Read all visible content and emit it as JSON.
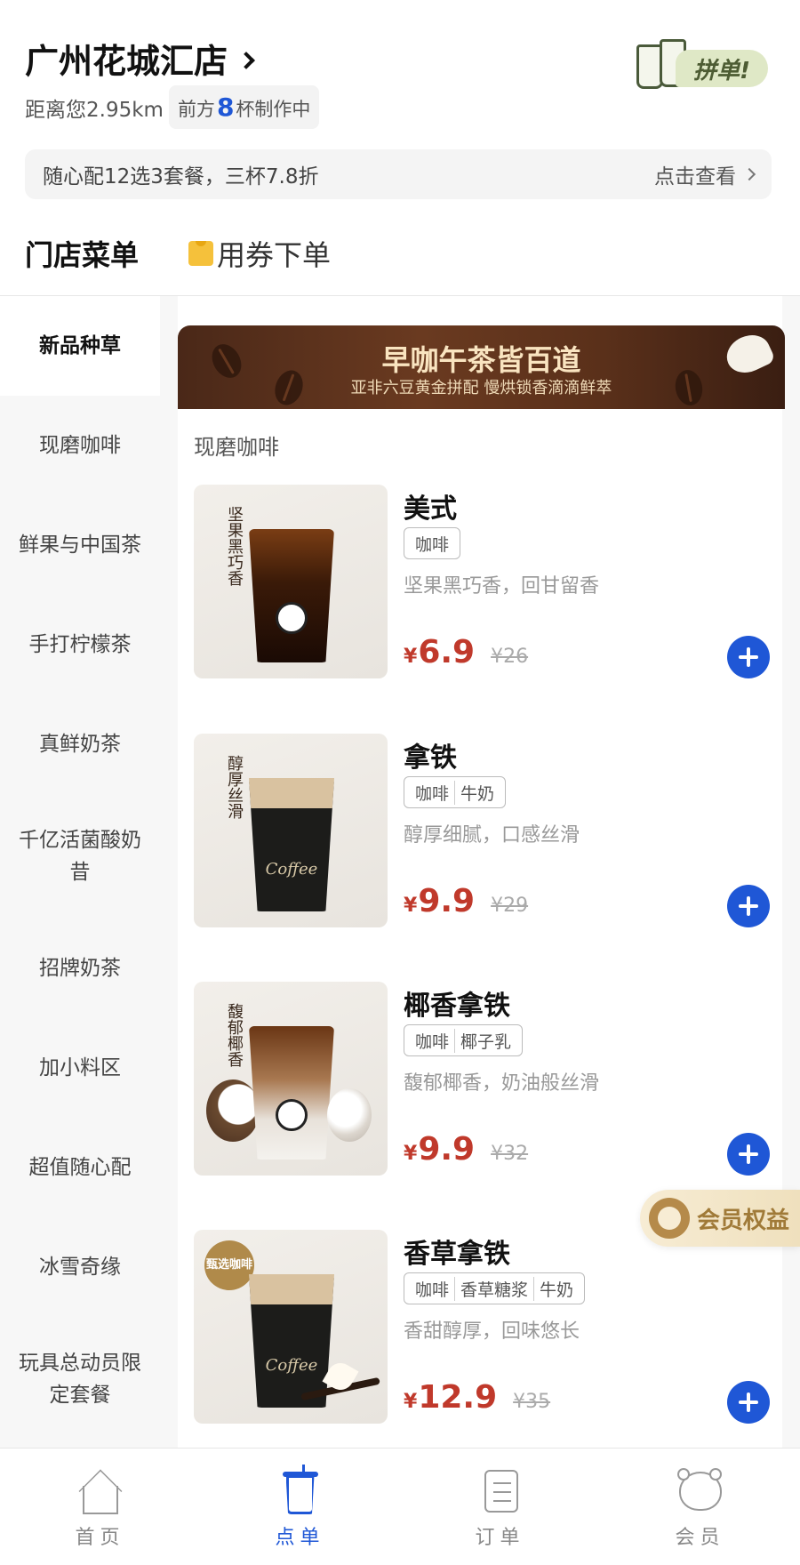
{
  "header": {
    "store_name": "广州花城汇店",
    "distance": "距离您2.95km",
    "queue_prefix": "前方",
    "queue_count": "8",
    "queue_suffix": "杯制作中",
    "group_order_label": "拼单!"
  },
  "promo": {
    "text": "随心配12选3套餐，三杯7.8折",
    "link": "点击查看"
  },
  "tabs": [
    {
      "label": "门店菜单",
      "active": true
    },
    {
      "label": "用券下单",
      "active": false
    }
  ],
  "sidebar": {
    "items": [
      {
        "label": "新品种草",
        "active": true
      },
      {
        "label": "现磨咖啡"
      },
      {
        "label": "鲜果与中国茶"
      },
      {
        "label": "手打柠檬茶"
      },
      {
        "label": "真鲜奶茶"
      },
      {
        "label": "千亿活菌酸奶昔"
      },
      {
        "label": "招牌奶茶"
      },
      {
        "label": "加小料区"
      },
      {
        "label": "超值随心配"
      },
      {
        "label": "冰雪奇缘"
      },
      {
        "label": "玩具总动员限定套餐"
      }
    ]
  },
  "banner": {
    "title": "早咖午茶皆百道",
    "subtitle": "亚非六豆黄金拼配  慢烘锁香滴滴鲜萃"
  },
  "section_title": "现磨咖啡",
  "products": [
    {
      "name": "美式",
      "tags": [
        "咖啡"
      ],
      "desc": "坚果黑巧香，回甘留香",
      "currency": "¥",
      "price": "6.9",
      "old_price": "¥26",
      "image_text": "坚果黑巧香"
    },
    {
      "name": "拿铁",
      "tags": [
        "咖啡",
        "牛奶"
      ],
      "desc": "醇厚细腻，口感丝滑",
      "currency": "¥",
      "price": "9.9",
      "old_price": "¥29",
      "image_text": "醇厚丝滑",
      "cup_brand": "Coffee"
    },
    {
      "name": "椰香拿铁",
      "tags": [
        "咖啡",
        "椰子乳"
      ],
      "desc": "馥郁椰香，奶油般丝滑",
      "currency": "¥",
      "price": "9.9",
      "old_price": "¥32",
      "image_text": "馥郁椰香"
    },
    {
      "name": "香草拿铁",
      "tags": [
        "咖啡",
        "香草糖浆",
        "牛奶"
      ],
      "desc": "香甜醇厚，回味悠长",
      "currency": "¥",
      "price": "12.9",
      "old_price": "¥35",
      "image_badge": "甄选咖啡",
      "cup_brand": "Coffee"
    }
  ],
  "member_float": {
    "label": "会员权益"
  },
  "bottom_nav": [
    {
      "label": "首页",
      "icon": "home-icon",
      "active": false
    },
    {
      "label": "点单",
      "icon": "cup-icon",
      "active": true
    },
    {
      "label": "订单",
      "icon": "order-icon",
      "active": false
    },
    {
      "label": "会员",
      "icon": "member-icon",
      "active": false
    }
  ],
  "colors": {
    "accent": "#1f57d6",
    "price": "#c0392b",
    "tab_underline": "#b8d2f4"
  }
}
